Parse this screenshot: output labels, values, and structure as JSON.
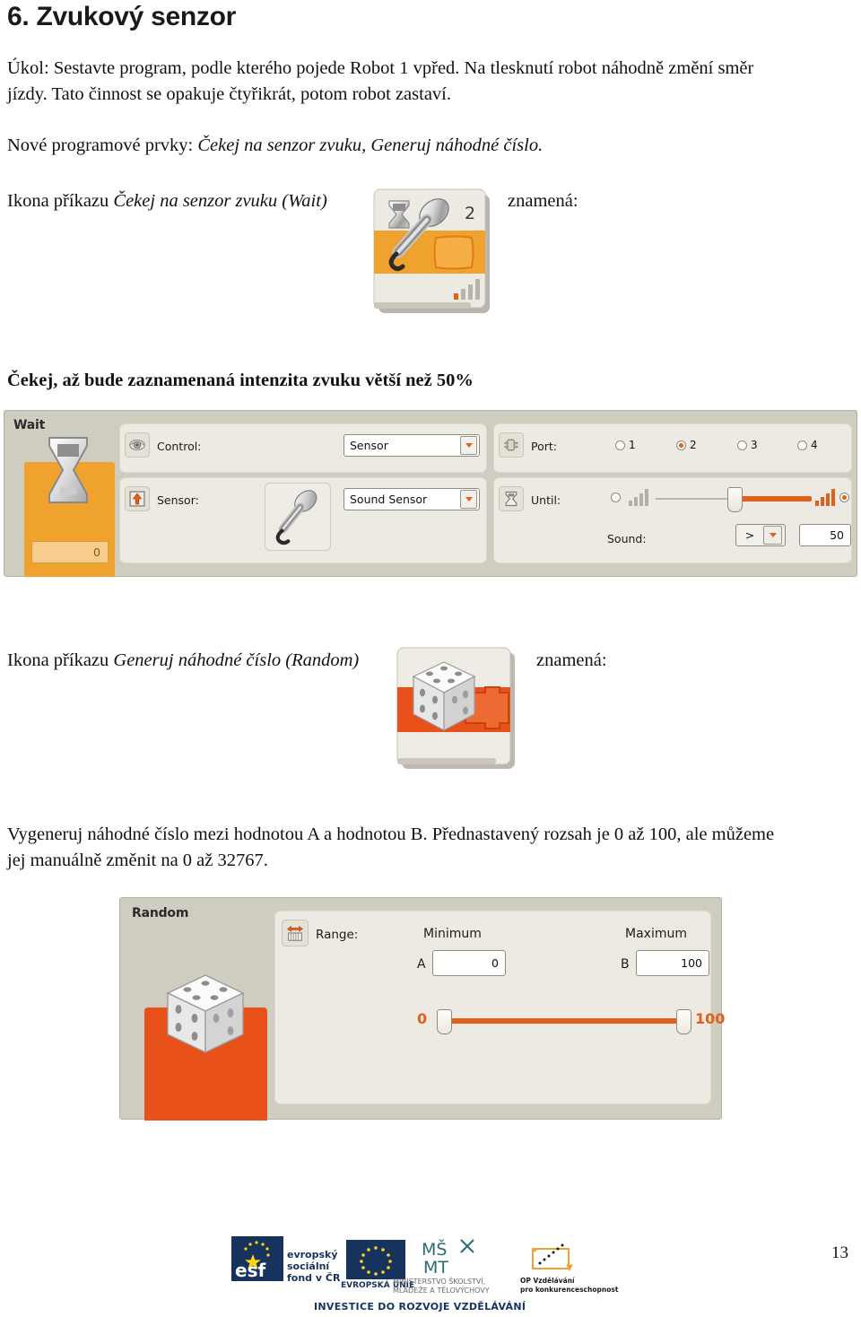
{
  "document": {
    "heading": "6. Zvukový senzor",
    "page_number": "13"
  },
  "intro": {
    "task_line1": "Úkol: Sestavte program, podle kterého pojede Robot 1 vpřed. Na tlesknutí robot náhodně změní směr",
    "task_line2": "jízdy. Tato činnost se opakuje čtyřikrát, potom robot zastaví.",
    "new_elements_prefix": "Nové programové prvky: ",
    "new_elements_italic": "Čekej na senzor zvuku, Generuj náhodné číslo."
  },
  "wait_section": {
    "caption_prefix": "Ikona příkazu ",
    "caption_italic": "Čekej na senzor zvuku (Wait)",
    "caption_suffix": "znamená:",
    "explanation": "Čekej, až bude zaznamenaná intenzita zvuku větší než 50%",
    "icon": {
      "port_number": "2",
      "hourglass_icon": "hourglass-icon",
      "microphone_icon": "microphone-icon",
      "sound_bars_icon": "sound-level-bars-icon"
    },
    "panel": {
      "block_name": "Wait",
      "preview_value": "0",
      "control_label": "Control:",
      "control_value": "Sensor",
      "control_icon": "eye-icon",
      "sensor_label": "Sensor:",
      "sensor_value": "Sound Sensor",
      "sensor_icon": "arrow-up-in-box-icon",
      "sensor_preview_icon": "microphone-icon",
      "port_label": "Port:",
      "port_icon": "plug-icon",
      "port_options": [
        "1",
        "2",
        "3",
        "4"
      ],
      "port_selected": "2",
      "until_label": "Until:",
      "until_icon": "hourglass-icon",
      "until_slider_percent": 50,
      "until_left_icon": "sound-bars-gray-icon",
      "until_right_icon": "sound-bars-orange-icon",
      "until_left_radio_selected": false,
      "until_right_radio_selected": true,
      "sound_label": "Sound:",
      "sound_operator": ">",
      "sound_threshold": "50"
    }
  },
  "random_section": {
    "caption_prefix": "Ikona příkazu ",
    "caption_italic": "Generuj náhodné číslo (Random)",
    "caption_suffix": "znamená:",
    "icon": {
      "die_icon": "dice-icon"
    },
    "explanation_line1": "Vygeneruj náhodné číslo mezi hodnotou A a hodnotou B. Přednastavený rozsah je 0 až 100, ale můžeme",
    "explanation_line2": "jej manuálně změnit na 0 až 32767.",
    "panel": {
      "block_name": "Random",
      "range_label": "Range:",
      "range_icon": "range-arrows-icon",
      "minimum_label": "Minimum",
      "maximum_label": "Maximum",
      "a_label": "A",
      "a_value": "0",
      "b_label": "B",
      "b_value": "100",
      "slider_min_display": "0",
      "slider_max_display": "100",
      "slider_min_percent": 0,
      "slider_max_percent": 100,
      "die_icon": "dice-icon"
    }
  },
  "footer": {
    "esf_logo_text": "esf",
    "esf_line1": "evropský",
    "esf_line2": "sociální",
    "esf_line3": "fond v ČR",
    "eu_label": "EVROPSKÁ UNIE",
    "msmt_logo_text": "MŠMT",
    "msmt_line1": "MINISTERSTVO ŠKOLSTVÍ,",
    "msmt_line2": "MLÁDEŽE A TĚLOVÝCHOVY",
    "op_line1": "OP Vzdělávání",
    "op_line2": "pro konkurenceschopnost",
    "tagline": "INVESTICE DO ROZVOJE VZDĚLÁVÁNÍ"
  },
  "colors": {
    "wait_orange": "#f0a22e",
    "random_orange": "#e8521a",
    "panel_bg": "#cfccc0",
    "group_bg": "#eceae2",
    "accent": "#e2611a",
    "eu_blue": "#16335e"
  }
}
